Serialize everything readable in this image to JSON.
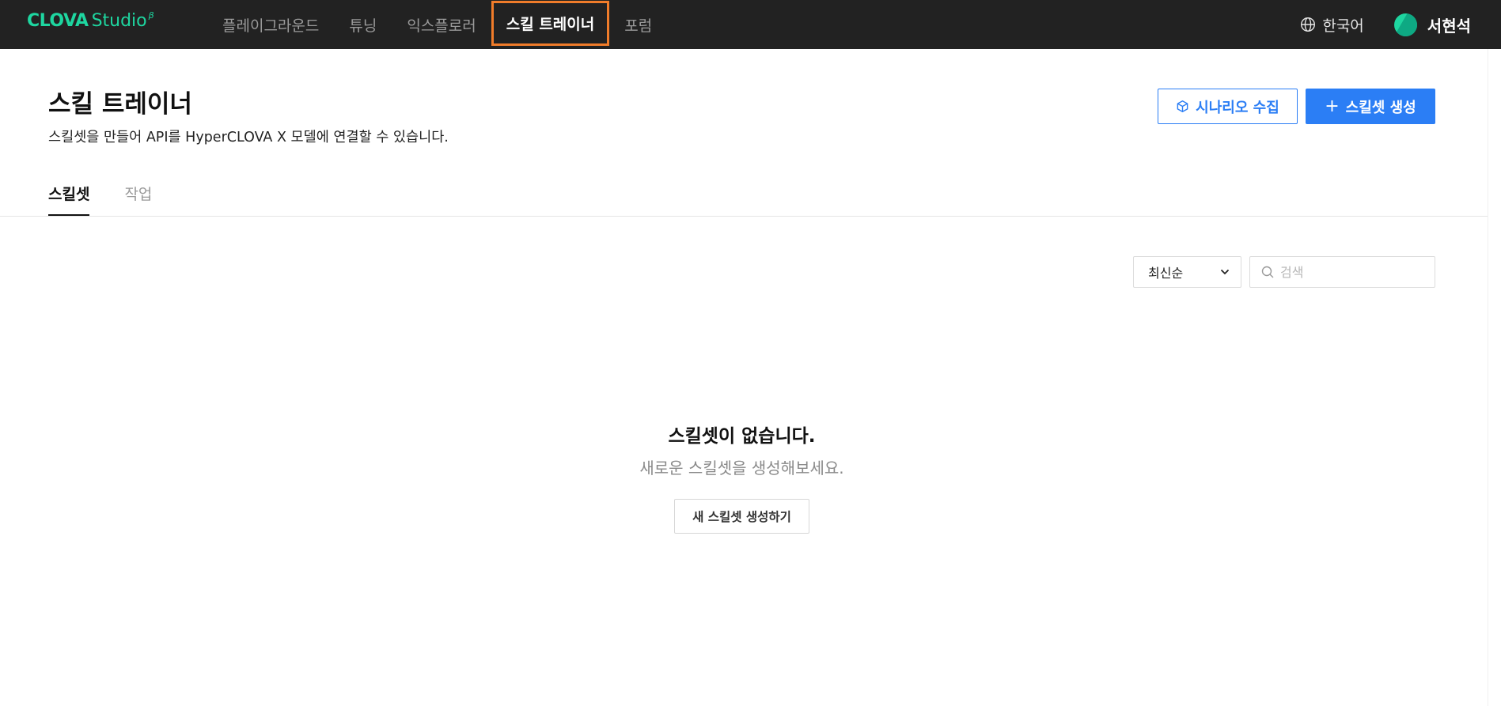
{
  "nav": {
    "logo_brand": "CLOVA",
    "logo_product": "Studio",
    "logo_beta": "β",
    "items": [
      {
        "label": "플레이그라운드",
        "active": false
      },
      {
        "label": "튜닝",
        "active": false
      },
      {
        "label": "익스플로러",
        "active": false
      },
      {
        "label": "스킬 트레이너",
        "active": true
      },
      {
        "label": "포럼",
        "active": false
      }
    ],
    "language": "한국어",
    "user_name": "서현석"
  },
  "header": {
    "title": "스킬 트레이너",
    "description": "스킬셋을 만들어 API를 HyperCLOVA X 모델에 연결할 수 있습니다.",
    "collect_button": "시나리오 수집",
    "create_button": "스킬셋 생성"
  },
  "tabs": [
    {
      "label": "스킬셋",
      "active": true
    },
    {
      "label": "작업",
      "active": false
    }
  ],
  "filters": {
    "sort_selected": "최신순",
    "search_placeholder": "검색",
    "search_value": ""
  },
  "empty_state": {
    "title": "스킬셋이 없습니다.",
    "subtitle": "새로운 스킬셋을 생성해보세요.",
    "button": "새 스킬셋 생성하기"
  },
  "colors": {
    "nav_bg": "#222222",
    "brand": "#1ed6a0",
    "primary": "#2b7ef5",
    "highlight": "#f07c2a"
  }
}
